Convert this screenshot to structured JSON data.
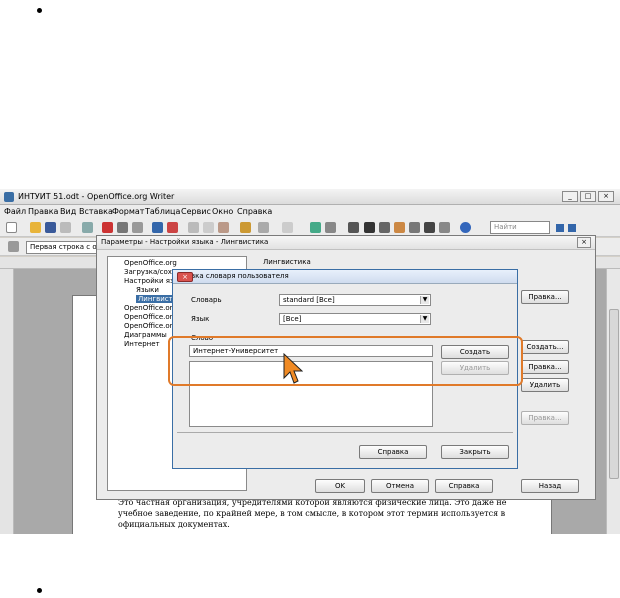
{
  "window": {
    "title": "ИНТУИТ 51.odt - OpenOffice.org Writer"
  },
  "menu": [
    "Файл",
    "Правка",
    "Вид",
    "Вставка",
    "Формат",
    "Таблица",
    "Сервис",
    "Окно",
    "Справка"
  ],
  "toolbar": {
    "find_placeholder": "Найти"
  },
  "format": {
    "style_value": "Первая строка с отс"
  },
  "options_dialog": {
    "title": "Параметры - Настройки языка - Лингвистика",
    "tree": [
      "OpenOffice.org",
      "Загрузка/сохра",
      "Настройки язы",
      "Языки",
      "Лингвистик",
      "OpenOffice.org",
      "OpenOffice.org",
      "OpenOffice.org",
      "Диаграммы",
      "Интернет"
    ],
    "section": "Лингвистика",
    "side_buttons": [
      "Правка...",
      "Создать...",
      "Правка...",
      "Удалить",
      "Правка..."
    ],
    "ok": "OK",
    "cancel": "Отмена",
    "help": "Справка",
    "back": "Назад"
  },
  "dict_dialog": {
    "title": "Правка словаря пользователя",
    "dictionary_label": "Словарь",
    "dictionary_value": "standard [Все]",
    "language_label": "Язык",
    "language_value": "[Все]",
    "word_label": "Слово",
    "word_value": "Интернет-Университет",
    "create": "Создать",
    "delete": "Удалить",
    "help": "Справка",
    "close": "Закрыть"
  },
  "document": {
    "text": "Это частная организация, учредителями которой являются физические лица. Это даже не учебное заведение, по крайней мере, в том смысле, в котором этот термин используется в официальных документах."
  }
}
